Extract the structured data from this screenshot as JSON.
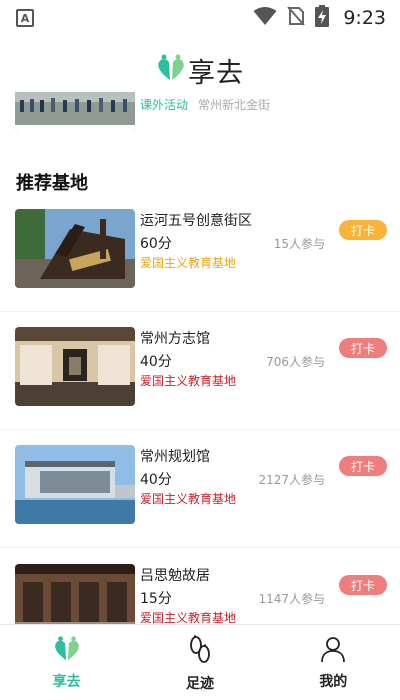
{
  "status_bar": {
    "time": "9:23",
    "notification_icon": "A",
    "icons": [
      "wifi-icon",
      "no-sim-icon",
      "battery-charging-icon"
    ]
  },
  "header": {
    "title": "享去"
  },
  "partial_item": {
    "tag": "课外活动",
    "location": "常州新北金街"
  },
  "section": {
    "title": "推荐基地"
  },
  "items": [
    {
      "name": "运河五号创意街区",
      "score": "60分",
      "category": "爱国主义教育基地",
      "participants": "15人参与",
      "button": "打卡",
      "category_color": "#e6a817",
      "button_color": "#f7b33a"
    },
    {
      "name": "常州方志馆",
      "score": "40分",
      "category": "爱国主义教育基地",
      "participants": "706人参与",
      "button": "打卡",
      "category_color": "#c8232b",
      "button_color": "#ee7d7d"
    },
    {
      "name": "常州规划馆",
      "score": "40分",
      "category": "爱国主义教育基地",
      "participants": "2127人参与",
      "button": "打卡",
      "category_color": "#c8232b",
      "button_color": "#ee7d7d"
    },
    {
      "name": "吕思勉故居",
      "score": "15分",
      "category": "爱国主义教育基地",
      "participants": "1147人参与",
      "button": "打卡",
      "category_color": "#c8232b",
      "button_color": "#ee7d7d"
    }
  ],
  "bottom_nav": [
    {
      "label": "享去",
      "icon": "heart-logo-icon",
      "active": true
    },
    {
      "label": "足迹",
      "icon": "footprints-icon",
      "active": false
    },
    {
      "label": "我的",
      "icon": "user-icon",
      "active": false
    }
  ],
  "colors": {
    "accent": "#2bbfa0",
    "nav_active": "#2bbfa0",
    "nav_inactive": "#222222"
  }
}
